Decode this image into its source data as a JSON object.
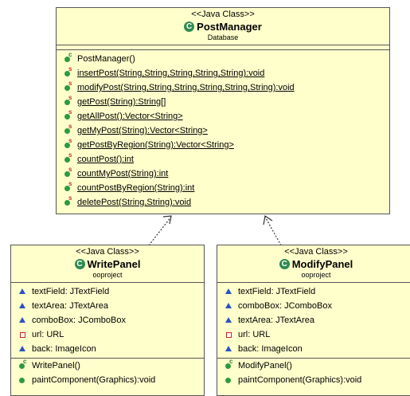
{
  "post_manager": {
    "stereotype": "<<Java Class>>",
    "name": "PostManager",
    "package": "Database",
    "icon": "class-icon",
    "attributes": [],
    "operations": [
      {
        "label": "PostManager()",
        "kind": "constructor"
      },
      {
        "label": "insertPost(String,String,String,String,String):void",
        "kind": "static"
      },
      {
        "label": "modifyPost(String,String,String,String,String,String):void",
        "kind": "static"
      },
      {
        "label": "getPost(String):String[]",
        "kind": "static"
      },
      {
        "label": "getAllPost():Vector<String>",
        "kind": "static"
      },
      {
        "label": "getMyPost(String):Vector<String>",
        "kind": "static"
      },
      {
        "label": "getPostByRegion(String):Vector<String>",
        "kind": "static"
      },
      {
        "label": "countPost():int",
        "kind": "static"
      },
      {
        "label": "countMyPost(String):int",
        "kind": "static"
      },
      {
        "label": "countPostByRegion(String):int",
        "kind": "static"
      },
      {
        "label": "deletePost(String,String):void",
        "kind": "static"
      }
    ]
  },
  "write_panel": {
    "stereotype": "<<Java Class>>",
    "name": "WritePanel",
    "package": "ooproject",
    "attributes": [
      {
        "label": "textField: JTextField",
        "visibility": "package"
      },
      {
        "label": "textArea: JTextArea",
        "visibility": "package"
      },
      {
        "label": "comboBox: JComboBox",
        "visibility": "package"
      },
      {
        "label": "url: URL",
        "visibility": "private"
      },
      {
        "label": "back: ImageIcon",
        "visibility": "package"
      }
    ],
    "operations": [
      {
        "label": "WritePanel()",
        "kind": "constructor"
      },
      {
        "label": "paintComponent(Graphics):void",
        "kind": "public"
      }
    ]
  },
  "modify_panel": {
    "stereotype": "<<Java Class>>",
    "name": "ModifyPanel",
    "package": "ooproject",
    "attributes": [
      {
        "label": "textField: JTextField",
        "visibility": "package"
      },
      {
        "label": "comboBox: JComboBox",
        "visibility": "package"
      },
      {
        "label": "textArea: JTextArea",
        "visibility": "package"
      },
      {
        "label": "url: URL",
        "visibility": "private"
      },
      {
        "label": "back: ImageIcon",
        "visibility": "package"
      }
    ],
    "operations": [
      {
        "label": "ModifyPanel()",
        "kind": "constructor"
      },
      {
        "label": "paintComponent(Graphics):void",
        "kind": "public"
      }
    ]
  },
  "relations": [
    {
      "from": "WritePanel",
      "to": "PostManager",
      "type": "dependency"
    },
    {
      "from": "ModifyPanel",
      "to": "PostManager",
      "type": "dependency"
    }
  ]
}
